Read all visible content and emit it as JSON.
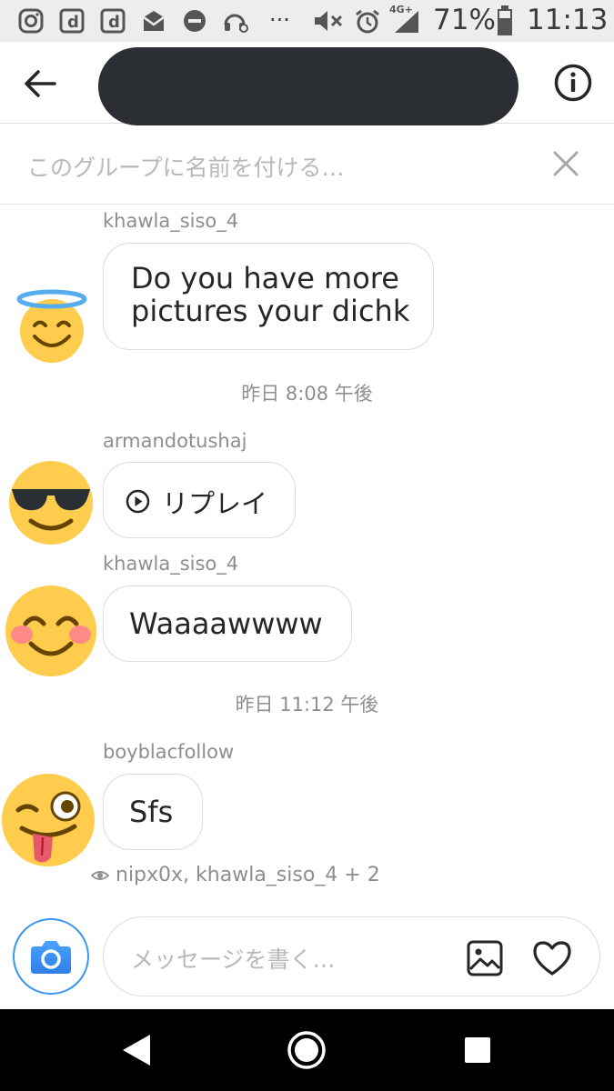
{
  "status_bar": {
    "battery_text": "71%",
    "time": "11:13",
    "network_badge": "4G+",
    "overflow": "···",
    "icons": [
      "instagram-icon",
      "d-app-icon",
      "d-app-icon",
      "mail-icon",
      "do-not-disturb-icon",
      "headphone-settings-icon",
      "mute-icon",
      "alarm-icon",
      "signal-icon",
      "battery-icon"
    ]
  },
  "header": {
    "back_icon": "arrow-left-icon",
    "info_icon": "info-icon"
  },
  "group_name": {
    "placeholder": "このグループに名前を付ける…"
  },
  "thread": {
    "messages": [
      {
        "sender": "khawla_siso_4",
        "lines": [
          "Do you have more",
          "pictures your dichk"
        ],
        "avatar": "smiling-face-with-halo-emoji"
      },
      {
        "timestamp": "昨日 8:08 午後"
      },
      {
        "sender": "armandotushaj",
        "replay_label": "リプレイ",
        "avatar": "smiling-face-with-sunglasses-emoji"
      },
      {
        "sender": "khawla_siso_4",
        "text": "Waaaawwww",
        "avatar": "smiling-face-with-blush-emoji"
      },
      {
        "timestamp": "昨日 11:12 午後"
      },
      {
        "sender": "boyblacfollow",
        "text": "Sfs",
        "avatar": "winking-face-with-tongue-emoji"
      }
    ],
    "seen_by": "nipx0x, khawla_siso_4 + 2"
  },
  "composer": {
    "placeholder": "メッセージを書く…",
    "camera_icon": "camera-icon",
    "gallery_icon": "image-icon",
    "like_icon": "heart-icon"
  },
  "nav_bar": {
    "icons": [
      "back-triangle-icon",
      "home-circle-icon",
      "recents-square-icon"
    ]
  },
  "colors": {
    "accent": "#3897f0",
    "emoji_yellow": "#ffcc4d",
    "redaction": "#2b2f33"
  }
}
